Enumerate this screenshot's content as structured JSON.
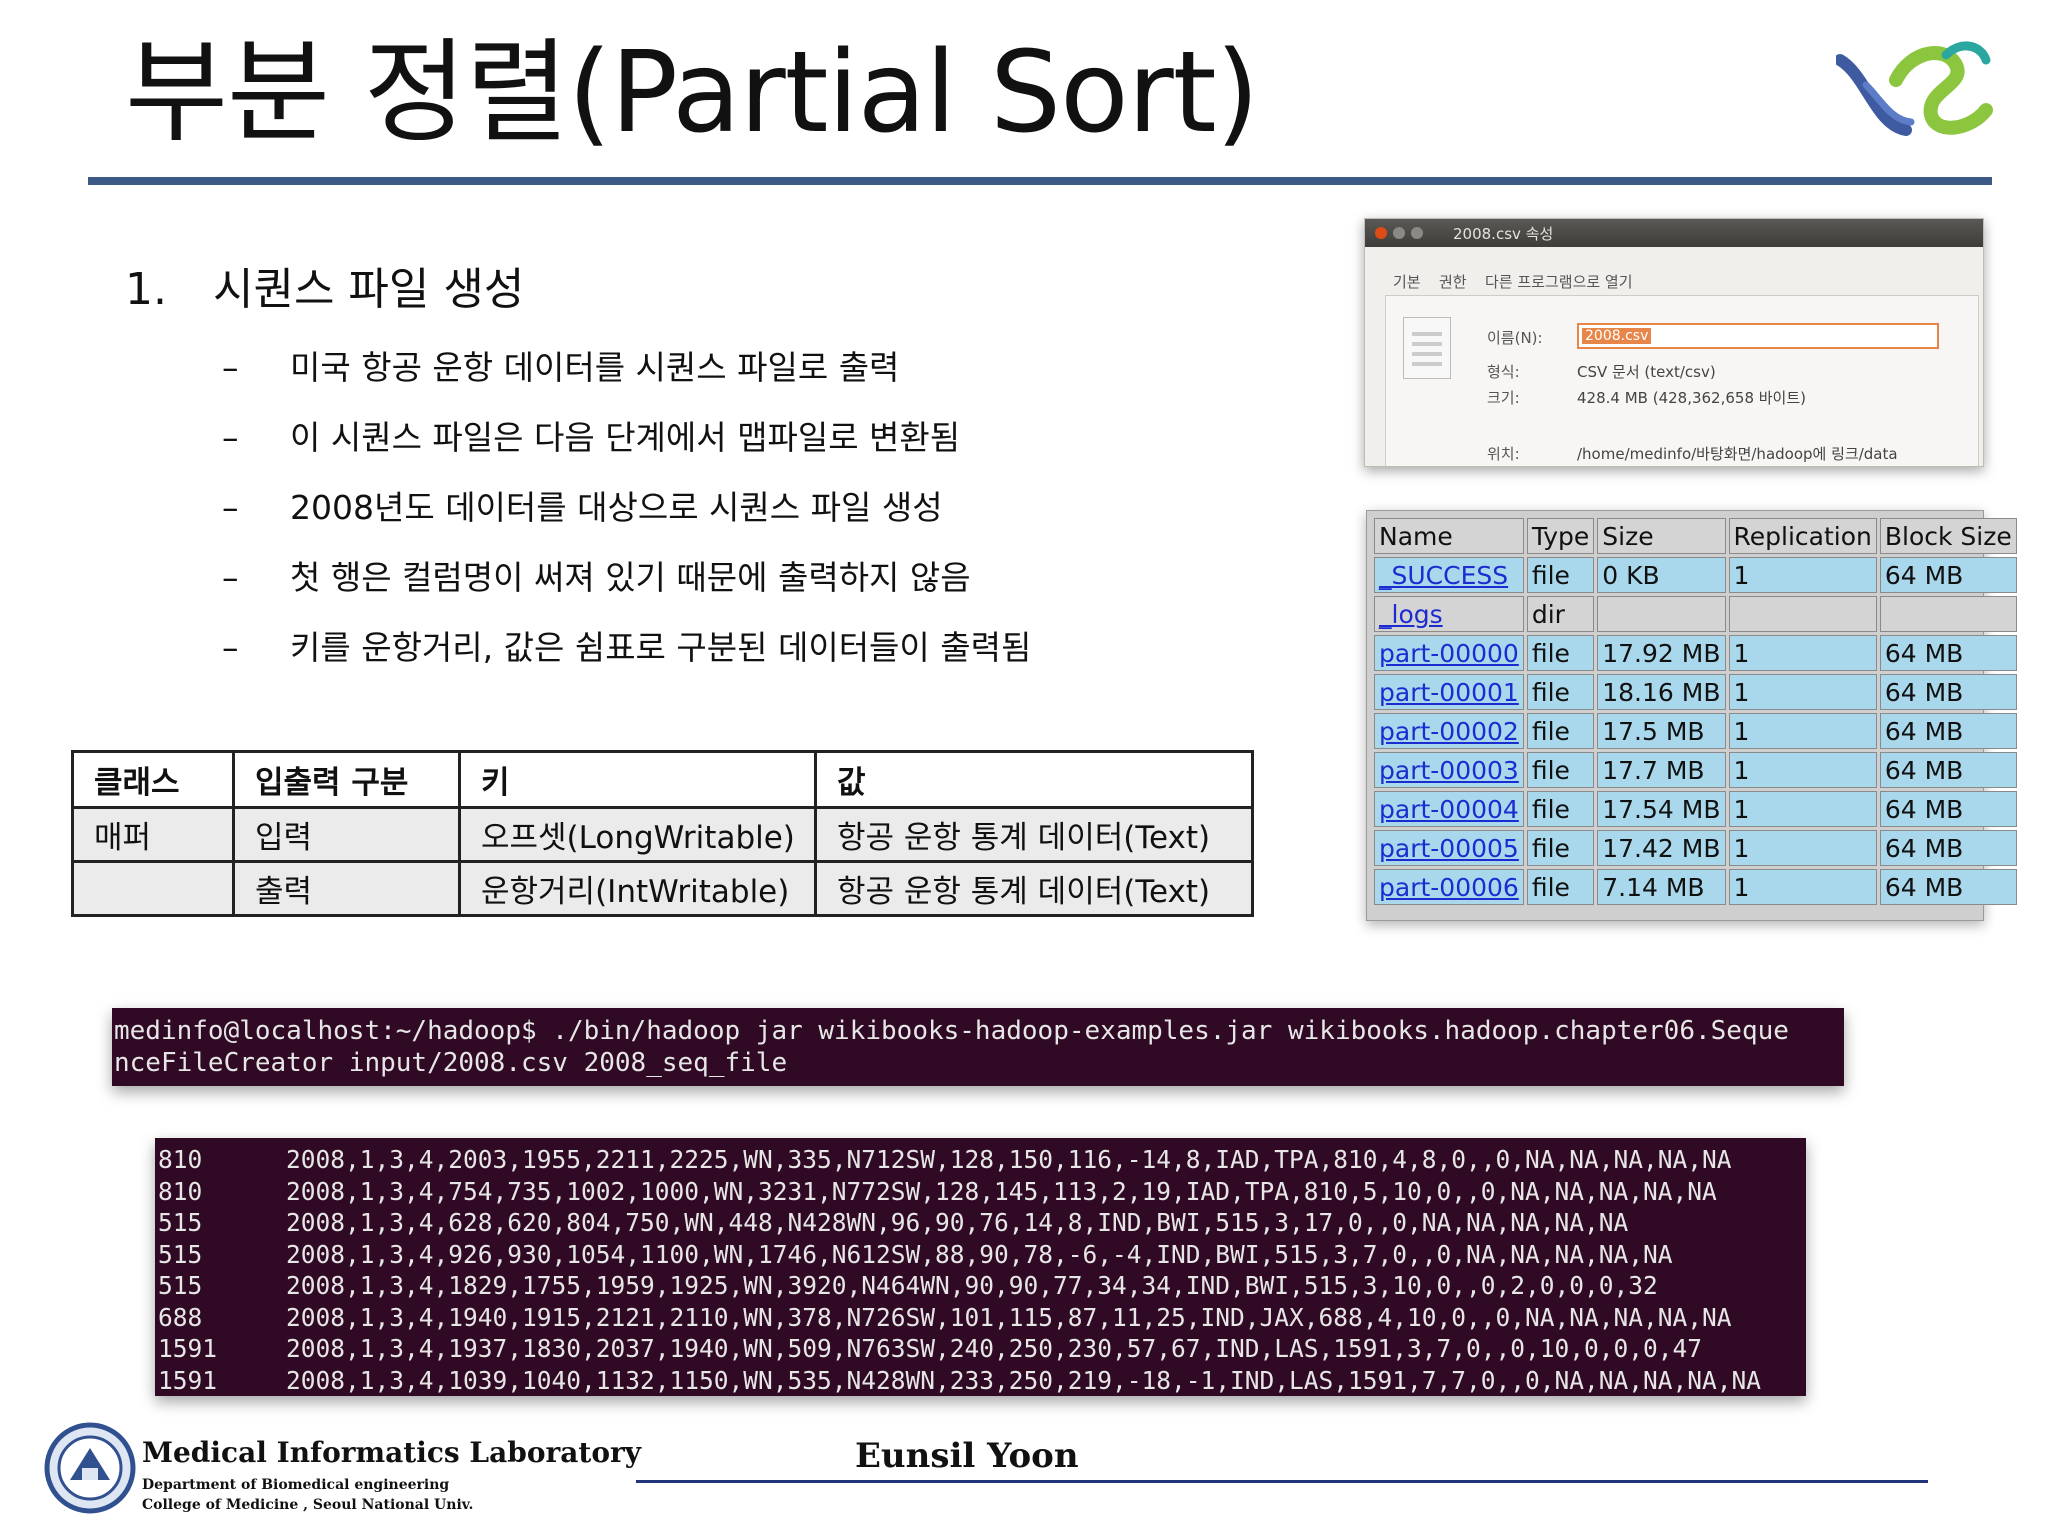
{
  "title": "부분 정렬(Partial Sort)",
  "heading": {
    "number": "1.",
    "text": "시퀀스 파일 생성"
  },
  "bullets": [
    {
      "dash": "–",
      "text": "미국 항공 운항 데이터를 시퀀스 파일로 출력"
    },
    {
      "dash": "–",
      "text": "이 시퀀스 파일은 다음 단계에서 맵파일로 변환됨"
    },
    {
      "dash": "–",
      "text": "2008년도 데이터를 대상으로 시퀀스 파일 생성"
    },
    {
      "dash": "–",
      "text": "첫 행은 컬럼명이 써져 있기 때문에 출력하지 않음"
    },
    {
      "dash": "–",
      "text": "키를 운항거리, 값은 쉼표로 구분된 데이터들이 출력됨"
    }
  ],
  "class_table": {
    "headers": [
      "클래스",
      "입출력 구분",
      "키",
      "값"
    ],
    "rows": [
      [
        "매퍼",
        "입력",
        "오프셋(LongWritable)",
        "항공 운항 통계 데이터(Text)"
      ],
      [
        "",
        "출력",
        "운항거리(IntWritable)",
        "항공 운항 통계 데이터(Text)"
      ]
    ]
  },
  "properties_window": {
    "title": "2008.csv 속성",
    "tabs": [
      "기본",
      "권한",
      "다른 프로그램으로 열기"
    ],
    "name_label": "이름(N):",
    "name_value": "2008.csv",
    "type_label": "형식:",
    "type_value": "CSV 문서 (text/csv)",
    "size_label": "크기:",
    "size_value": "428.4 MB (428,362,658 바이트)",
    "location_label": "위치:",
    "location_value": "/home/medinfo/바탕화면/hadoop에 링크/data"
  },
  "hdfs_table": {
    "headers": [
      "Name",
      "Type",
      "Size",
      "Replication",
      "Block Size"
    ],
    "rows": [
      [
        "_SUCCESS",
        "file",
        "0 KB",
        "1",
        "64 MB"
      ],
      [
        "_logs",
        "dir",
        "",
        "",
        ""
      ],
      [
        "part-00000",
        "file",
        "17.92 MB",
        "1",
        "64 MB"
      ],
      [
        "part-00001",
        "file",
        "18.16 MB",
        "1",
        "64 MB"
      ],
      [
        "part-00002",
        "file",
        "17.5 MB",
        "1",
        "64 MB"
      ],
      [
        "part-00003",
        "file",
        "17.7 MB",
        "1",
        "64 MB"
      ],
      [
        "part-00004",
        "file",
        "17.54 MB",
        "1",
        "64 MB"
      ],
      [
        "part-00005",
        "file",
        "17.42 MB",
        "1",
        "64 MB"
      ],
      [
        "part-00006",
        "file",
        "7.14 MB",
        "1",
        "64 MB"
      ]
    ]
  },
  "terminal_command": [
    "medinfo@localhost:~/hadoop$ ./bin/hadoop jar wikibooks-hadoop-examples.jar wikibooks.hadoop.chapter06.Seque",
    "nceFileCreator input/2008.csv 2008_seq_file"
  ],
  "terminal_output": [
    {
      "key": "810",
      "value": "2008,1,3,4,2003,1955,2211,2225,WN,335,N712SW,128,150,116,-14,8,IAD,TPA,810,4,8,0,,0,NA,NA,NA,NA,NA"
    },
    {
      "key": "810",
      "value": "2008,1,3,4,754,735,1002,1000,WN,3231,N772SW,128,145,113,2,19,IAD,TPA,810,5,10,0,,0,NA,NA,NA,NA,NA"
    },
    {
      "key": "515",
      "value": "2008,1,3,4,628,620,804,750,WN,448,N428WN,96,90,76,14,8,IND,BWI,515,3,17,0,,0,NA,NA,NA,NA,NA"
    },
    {
      "key": "515",
      "value": "2008,1,3,4,926,930,1054,1100,WN,1746,N612SW,88,90,78,-6,-4,IND,BWI,515,3,7,0,,0,NA,NA,NA,NA,NA"
    },
    {
      "key": "515",
      "value": "2008,1,3,4,1829,1755,1959,1925,WN,3920,N464WN,90,90,77,34,34,IND,BWI,515,3,10,0,,0,2,0,0,0,32"
    },
    {
      "key": "688",
      "value": "2008,1,3,4,1940,1915,2121,2110,WN,378,N726SW,101,115,87,11,25,IND,JAX,688,4,10,0,,0,NA,NA,NA,NA,NA"
    },
    {
      "key": "1591",
      "value": "2008,1,3,4,1937,1830,2037,1940,WN,509,N763SW,240,250,230,57,67,IND,LAS,1591,3,7,0,,0,10,0,0,0,47"
    },
    {
      "key": "1591",
      "value": "2008,1,3,4,1039,1040,1132,1150,WN,535,N428WN,233,250,219,-18,-1,IND,LAS,1591,7,7,0,,0,NA,NA,NA,NA,NA"
    }
  ],
  "footer": {
    "lab_name": "Medical  Informatics Laboratory",
    "department": "Department of Biomedical engineering",
    "college": "College of Medicine , Seoul  National  Univ.",
    "author": "Eunsil Yoon"
  },
  "colors": {
    "title_rule": "#3d5a86",
    "terminal_bg": "#300a24",
    "hdfs_file_row": "#a9d8ec",
    "footer_rule": "#23357a"
  }
}
